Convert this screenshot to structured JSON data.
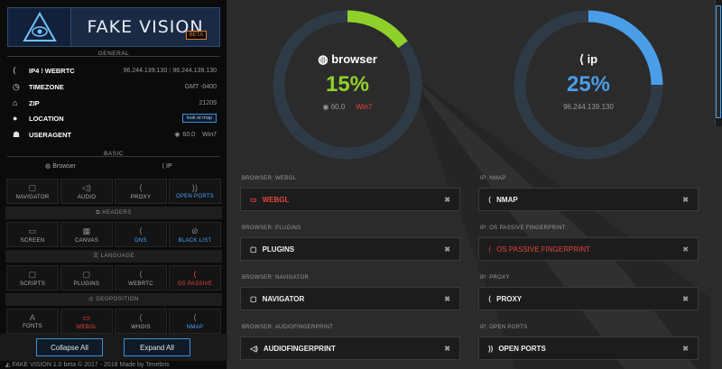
{
  "app": {
    "title": "FAKE VISION",
    "beta": "BETA"
  },
  "general": {
    "title": "GENERAL",
    "rows": [
      {
        "icon": "share-icon",
        "label": "IP4 ⁝ WEBRTC",
        "value": "96.244.139.130 ⁝ 96.244.139.130"
      },
      {
        "icon": "clock-icon",
        "label": "TIMEZONE",
        "value": "GMT -0400"
      },
      {
        "icon": "home-icon",
        "label": "ZIP",
        "value": "21209"
      },
      {
        "icon": "location-icon",
        "label": "LOCATION",
        "button": "look at map"
      },
      {
        "icon": "user-icon",
        "label": "USERAGENT",
        "browser": "60.0",
        "os": "Win7"
      }
    ]
  },
  "basic": {
    "title": "BASIC",
    "tabs": [
      "Browser",
      "IP"
    ],
    "row1": [
      "NAVIGATOR",
      "AUDIO",
      "PROXY",
      "OPEN PORTS"
    ],
    "headers": "HEADERS",
    "row2": [
      "SCREEN",
      "CANVAS",
      "DNS",
      "BLACK LIST"
    ],
    "language": "LANGUAGE",
    "row3": [
      "SCRIPTS",
      "PLUGINS",
      "WEBRTC",
      "OS PASSIVE"
    ],
    "geoposition": "GEOPOSITION",
    "row4": [
      "FONTS",
      "WEBGL",
      "WHOIS",
      "NMAP"
    ]
  },
  "buttons": {
    "collapse": "Collapse All",
    "expand": "Expand All"
  },
  "footer": "FAKE VISION 1.0 beta  © 2017 - 2018 Made by Tenebris",
  "gauges": {
    "browser": {
      "title": "browser",
      "percent_label": "15%",
      "value": 15,
      "version": "60.0",
      "os": "Win7",
      "color": "#8fd12a"
    },
    "ip": {
      "title": "ip",
      "percent_label": "25%",
      "value": 25,
      "address": "96.244.139.130",
      "color": "#4a9ee8"
    }
  },
  "cards": {
    "left": [
      {
        "label": "BROWSER: WEBGL",
        "text": "WEBGL",
        "icon": "monitor-icon",
        "alert": true
      },
      {
        "label": "BROWSER: PLUGINS",
        "text": "PLUGINS",
        "icon": "doc-icon",
        "alert": false
      },
      {
        "label": "BROWSER: NAVIGATOR",
        "text": "NAVIGATOR",
        "icon": "doc-icon",
        "alert": false
      },
      {
        "label": "BROWSER: AUDIOFINGERPRINT",
        "text": "AUDIOFINGERPRINT",
        "icon": "speaker-icon",
        "alert": false
      }
    ],
    "right": [
      {
        "label": "IP: NMAP",
        "text": "NMAP",
        "icon": "share-icon",
        "alert": false
      },
      {
        "label": "IP: OS PASSIVE FINGERPRINT",
        "text": "OS PASSIVE FINGERPRINT",
        "icon": "share-icon",
        "alert": true
      },
      {
        "label": "IP: PROXY",
        "text": "PROXY",
        "icon": "share-icon",
        "alert": false
      },
      {
        "label": "IP: OPEN PORTS",
        "text": "OPEN PORTS",
        "icon": "rss-icon",
        "alert": false
      }
    ]
  }
}
